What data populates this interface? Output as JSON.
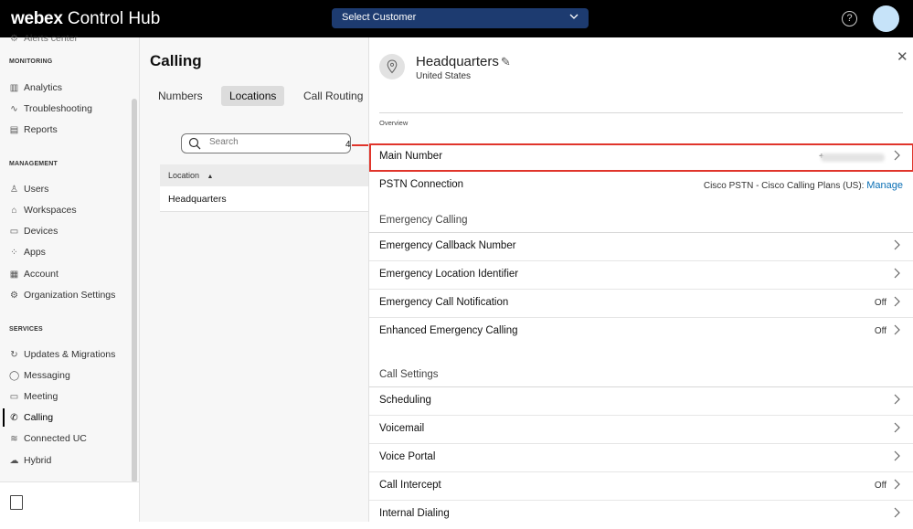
{
  "header": {
    "logo_brand": "webex",
    "logo_product": "Control Hub",
    "customer_select": "Select Customer"
  },
  "sidebar": {
    "partial_item": "Alerts center",
    "sections": [
      {
        "title": "MONITORING"
      },
      {
        "title": "MANAGEMENT"
      },
      {
        "title": "SERVICES"
      }
    ],
    "items": [
      {
        "label": "Analytics",
        "icon": "bar-chart-icon"
      },
      {
        "label": "Troubleshooting",
        "icon": "pulse-icon"
      },
      {
        "label": "Reports",
        "icon": "document-icon"
      },
      {
        "label": "Users",
        "icon": "user-icon"
      },
      {
        "label": "Workspaces",
        "icon": "workspace-icon"
      },
      {
        "label": "Devices",
        "icon": "device-icon"
      },
      {
        "label": "Apps",
        "icon": "apps-grid-icon"
      },
      {
        "label": "Account",
        "icon": "building-icon"
      },
      {
        "label": "Organization Settings",
        "icon": "gear-icon"
      },
      {
        "label": "Updates & Migrations",
        "icon": "refresh-icon"
      },
      {
        "label": "Messaging",
        "icon": "chat-icon"
      },
      {
        "label": "Meeting",
        "icon": "meeting-icon"
      },
      {
        "label": "Calling",
        "icon": "phone-icon"
      },
      {
        "label": "Connected UC",
        "icon": "stack-icon"
      },
      {
        "label": "Hybrid",
        "icon": "cloud-icon"
      }
    ],
    "active_item": "Calling"
  },
  "content": {
    "title": "Calling",
    "tabs": [
      {
        "label": "Numbers"
      },
      {
        "label": "Locations"
      },
      {
        "label": "Call Routing"
      }
    ],
    "active_tab": "Locations",
    "search_placeholder": "Search",
    "step_marker": "4",
    "table": {
      "column": "Location",
      "rows": [
        "Headquarters"
      ]
    }
  },
  "panel": {
    "location_name": "Headquarters",
    "country": "United States",
    "overview_label": "Overview",
    "main_number_label": "Main Number",
    "main_number_prefix": "+",
    "pstn_label": "PSTN Connection",
    "pstn_value": "Cisco PSTN - Cisco Calling Plans (US):",
    "pstn_manage": "Manage",
    "emergency_heading": "Emergency Calling",
    "emergency_rows": [
      {
        "label": "Emergency Callback Number",
        "value": ""
      },
      {
        "label": "Emergency Location Identifier",
        "value": ""
      },
      {
        "label": "Emergency Call Notification",
        "value": "Off"
      },
      {
        "label": "Enhanced Emergency Calling",
        "value": "Off"
      }
    ],
    "call_settings_heading": "Call Settings",
    "call_settings_rows": [
      {
        "label": "Scheduling",
        "value": ""
      },
      {
        "label": "Voicemail",
        "value": ""
      },
      {
        "label": "Voice Portal",
        "value": ""
      },
      {
        "label": "Call Intercept",
        "value": "Off"
      },
      {
        "label": "Internal Dialing",
        "value": ""
      }
    ]
  },
  "colors": {
    "highlight": "#e0352b",
    "customer_select_bg": "#1d3b70",
    "link": "#0a6fb5"
  }
}
